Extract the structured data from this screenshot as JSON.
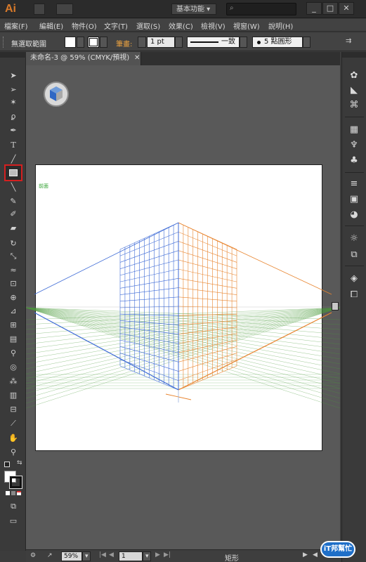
{
  "app": {
    "logo": "Ai"
  },
  "titlebar": {
    "workspace_label": "基本功能",
    "search_placeholder": ""
  },
  "window_controls": {
    "minimize": "_",
    "maximize": "□",
    "close": "✕"
  },
  "menus": [
    "檔案(F)",
    "編輯(E)",
    "物件(O)",
    "文字(T)",
    "選取(S)",
    "效果(C)",
    "檢視(V)",
    "視窗(W)",
    "說明(H)"
  ],
  "control": {
    "selection_label": "無選取範圍",
    "stroke_label": "筆畫:",
    "stroke_value": "1 pt",
    "profile_label": "一致",
    "brush_label": "5 點圓形"
  },
  "document": {
    "tab_title": "未命名-3 @ 59% (CMYK/預視)",
    "artboard_label": "前面"
  },
  "status": {
    "zoom": "59%",
    "artboard_number": "1",
    "tool_name": "矩形"
  },
  "colors": {
    "accent": "#d97a2a",
    "grid_left": "#3d6ad6",
    "grid_right": "#e8842e",
    "grid_ground": "#4a9a3a",
    "selected_tool_outline": "#d42020"
  },
  "watermark": {
    "text": "iT邦幫忙"
  }
}
